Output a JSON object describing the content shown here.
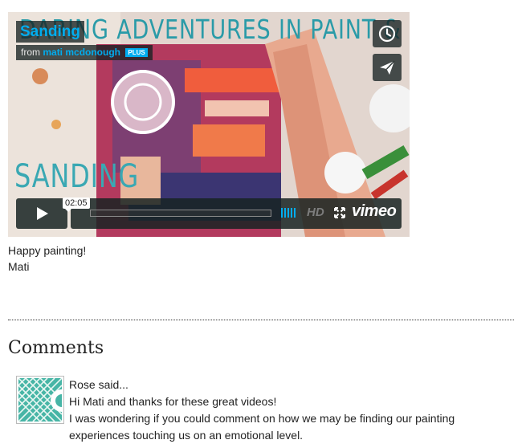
{
  "video": {
    "title": "Sanding",
    "byline_from": "from",
    "author": "mati mcdonough",
    "plus_badge": "PLUS",
    "banner_text": "DARING ADVENTURES IN PAINT & LIFE",
    "overlay_art_text": "SANDING",
    "tooltip_time": "02:05",
    "hd_label": "HD",
    "logo": "vimeo",
    "progress": 0.0,
    "icons": {
      "watch_later": "clock-icon",
      "share": "paper-plane-icon",
      "play": "play-icon",
      "volume": "volume-icon",
      "fullscreen": "fullscreen-icon"
    },
    "colors": {
      "accent": "#00adef",
      "control_bg": "#172322",
      "banner": "#2a9ba8"
    }
  },
  "post": {
    "line1": "Happy painting!",
    "line2": "Mati"
  },
  "comments": {
    "heading": "Comments",
    "items": [
      {
        "author_line": "Rose said...",
        "lines": [
          "Hi Mati and thanks for these great videos!",
          "I was wondering if you could comment on how we may be finding our painting experiences touching us on an emotional level."
        ]
      }
    ]
  }
}
